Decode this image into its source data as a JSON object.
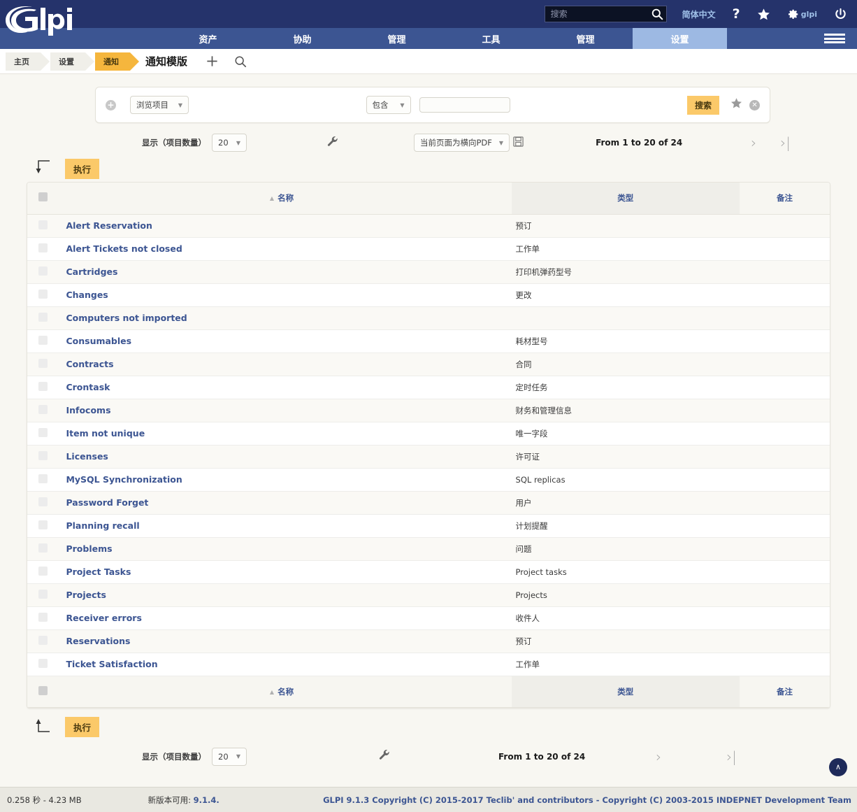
{
  "topbar": {
    "logo_text": "glpi",
    "search": {
      "placeholder": "搜索",
      "value": "",
      "icon": "search-icon"
    },
    "language": "简体中文",
    "help_icon": "question-mark-icon",
    "favorites_icon": "star-icon",
    "settings_icon": "gear-icon",
    "user_name": "glpi",
    "logout_icon": "power-icon"
  },
  "mainnav": {
    "items": [
      {
        "label": "资产",
        "active": false
      },
      {
        "label": "协助",
        "active": false
      },
      {
        "label": "管理",
        "active": false
      },
      {
        "label": "工具",
        "active": false
      },
      {
        "label": "管理",
        "active": false
      },
      {
        "label": "设置",
        "active": true
      }
    ],
    "menu_icon": "hamburger-menu-icon"
  },
  "breadcrumb": {
    "items": [
      {
        "label": "主页",
        "current": false
      },
      {
        "label": "设置",
        "current": false
      },
      {
        "label": "通知",
        "current": true
      }
    ],
    "page_title": "通知模版",
    "add_icon": "plus-icon",
    "search_icon": "search-icon"
  },
  "searchpanel": {
    "add_criteria_icon": "plus-circle-icon",
    "field_select": "浏览项目",
    "operator_select": "包含",
    "value_input": "",
    "search_button": "搜索",
    "save_star_icon": "star-icon",
    "reset_icon": "close-circle-icon"
  },
  "pagination_top": {
    "display_label": "显示（项目数量）",
    "page_size": "20",
    "config_icon": "wrench-icon",
    "export_select": "当前页面为横向PDF",
    "export_icon": "floppy-disk-icon",
    "range": "From 1 to 20 of 24",
    "next_icon": "chevron-right-icon",
    "last_icon": "chevron-last-icon"
  },
  "pagination_bottom": {
    "display_label": "显示（项目数量）",
    "page_size": "20",
    "config_icon": "wrench-icon",
    "range": "From 1 to 20 of 24",
    "next_icon": "chevron-right-icon",
    "last_icon": "chevron-last-icon"
  },
  "action_top": {
    "arrow_icon": "arrow-down-left-icon",
    "button_label": "执行"
  },
  "action_bottom": {
    "arrow_icon": "arrow-up-left-icon",
    "button_label": "执行"
  },
  "table": {
    "columns": [
      {
        "label": "名称",
        "sorted": true,
        "sort_dir": "asc"
      },
      {
        "label": "类型",
        "sorted": false
      },
      {
        "label": "备注",
        "sorted": false
      }
    ],
    "rows": [
      {
        "name": "Alert Reservation",
        "type": "预订",
        "note": ""
      },
      {
        "name": "Alert Tickets not closed",
        "type": "工作单",
        "note": ""
      },
      {
        "name": "Cartridges",
        "type": "打印机弹药型号",
        "note": ""
      },
      {
        "name": "Changes",
        "type": "更改",
        "note": ""
      },
      {
        "name": "Computers not imported",
        "type": "",
        "note": ""
      },
      {
        "name": "Consumables",
        "type": "耗材型号",
        "note": ""
      },
      {
        "name": "Contracts",
        "type": "合同",
        "note": ""
      },
      {
        "name": "Crontask",
        "type": "定时任务",
        "note": ""
      },
      {
        "name": "Infocoms",
        "type": "财务和管理信息",
        "note": ""
      },
      {
        "name": "Item not unique",
        "type": "唯一字段",
        "note": ""
      },
      {
        "name": "Licenses",
        "type": "许可证",
        "note": ""
      },
      {
        "name": "MySQL Synchronization",
        "type": "SQL replicas",
        "note": ""
      },
      {
        "name": "Password Forget",
        "type": "用户",
        "note": ""
      },
      {
        "name": "Planning recall",
        "type": "计划提醒",
        "note": ""
      },
      {
        "name": "Problems",
        "type": "问题",
        "note": ""
      },
      {
        "name": "Project Tasks",
        "type": "Project tasks",
        "note": ""
      },
      {
        "name": "Projects",
        "type": "Projects",
        "note": ""
      },
      {
        "name": "Receiver errors",
        "type": "收件人",
        "note": ""
      },
      {
        "name": "Reservations",
        "type": "预订",
        "note": ""
      },
      {
        "name": "Ticket Satisfaction",
        "type": "工作单",
        "note": ""
      }
    ]
  },
  "footer": {
    "stats": "0.258 秒 - 4.23 MB",
    "update_label": "新版本可用:",
    "update_version": "9.1.4.",
    "copyright": "GLPI 9.1.3 Copyright (C) 2015-2017 Teclib' and contributors - Copyright (C) 2003-2015 INDEPNET Development Team",
    "totop_icon": "chevron-up-icon"
  },
  "colors": {
    "navy": "#25336b",
    "nav_blue": "#3c5592",
    "nav_active": "#9db9e3",
    "accent_orange": "#fbc969",
    "link_blue": "#3c5592"
  }
}
